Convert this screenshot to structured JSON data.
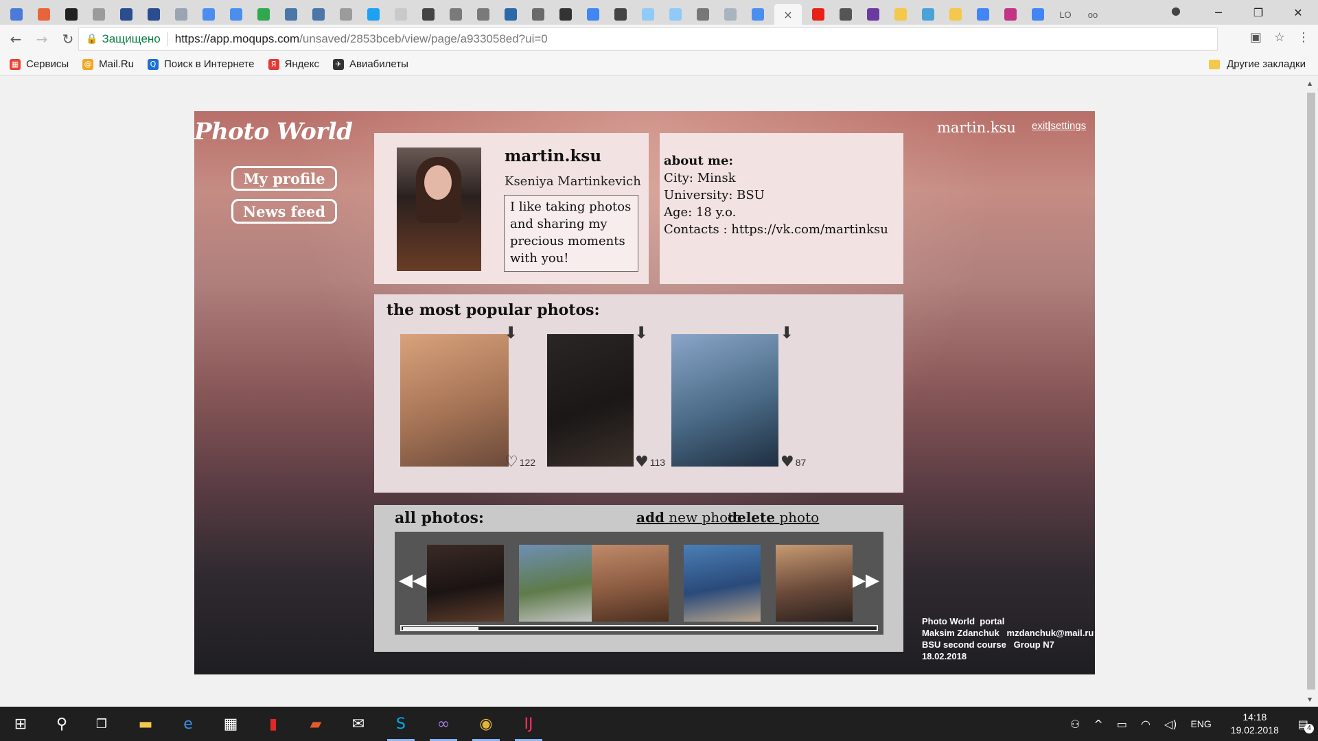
{
  "browser": {
    "tab_favicons": [
      "#4b7bd8",
      "#e8643a",
      "#222222",
      "#9b9b9b",
      "#2a4d8f",
      "#2a4d8f",
      "#9aa4b3",
      "#4a8ef0",
      "#4a8ef0",
      "#2fa84f",
      "#4a76a8",
      "#4a76a8",
      "#9b9b9b",
      "#1da1f2",
      "#c9c9c9",
      "#444444",
      "#7a7a7a",
      "#7a7a7a",
      "#2a6aa8",
      "#6a6a6a",
      "#333333",
      "#4285f4",
      "#444444",
      "#90caf9",
      "#90caf9",
      "#777777",
      "#aab4c0",
      "#4a8ef0"
    ],
    "active_tab_close": "×",
    "tabs_after": [
      "#e62117",
      "#555555",
      "#6a3aa1",
      "#f4c84a",
      "#4aa3d8",
      "#f4c84a",
      "#4285f4",
      "#c13584",
      "#4285f4"
    ],
    "tab_text_lo": "LO",
    "tab_text_oo": "oo",
    "window_minimize": "─",
    "window_restore": "❐",
    "window_close": "✕",
    "profile_icon": "●",
    "back_icon": "←",
    "forward_icon": "→",
    "reload_icon": "↻",
    "lock_icon": "🔒",
    "secure_label": "Защищено",
    "url_host": "https://app.moqups.com",
    "url_path": "/unsaved/2853bceb/view/page/a933058ed?ui=0",
    "translate_icon": "▣",
    "star_icon": "☆",
    "menu_icon": "⋮",
    "bookmarks": [
      {
        "label": "Сервисы",
        "icon": "apps-icon",
        "color": "#ea4335",
        "glyph": "▦"
      },
      {
        "label": "Mail.Ru",
        "icon": "mailru-icon",
        "color": "#f5a623",
        "glyph": "@"
      },
      {
        "label": "Поиск в Интернете",
        "icon": "search-icon",
        "color": "#1f6fd1",
        "glyph": "Q"
      },
      {
        "label": "Яндекс",
        "icon": "yandex-icon",
        "color": "#e53935",
        "glyph": "Я"
      },
      {
        "label": "Авиабилеты",
        "icon": "plane-icon",
        "color": "#333333",
        "glyph": "✈"
      }
    ],
    "other_bookmarks": "Другие закладки"
  },
  "app": {
    "logo": "Photo World",
    "nav_my_profile": "My profile",
    "nav_news_feed": "News feed",
    "top_username": "martin.ksu",
    "top_exit": "exit",
    "top_divider": "|",
    "top_settings": "settings",
    "profile": {
      "username": "martin.ksu",
      "full_name": "Kseniya Martinkevich",
      "bio": "I like taking photos and sharing my precious moments with you!"
    },
    "about": {
      "heading": "about me:",
      "city": "City: Minsk",
      "university": "University: BSU",
      "age": "Age: 18 y.o.",
      "contacts": "Contacts :  https://vk.com/martinksu"
    },
    "popular": {
      "title": "the most popular photos:",
      "photos": [
        {
          "likes": "122",
          "liked": false,
          "colors": [
            "#d9a27c",
            "#a67456",
            "#6b4a3a"
          ]
        },
        {
          "likes": "113",
          "liked": true,
          "colors": [
            "#2a2624",
            "#1a1716",
            "#3b302b"
          ]
        },
        {
          "likes": "87",
          "liked": true,
          "colors": [
            "#8aa5c8",
            "#4a6a86",
            "#1f2f40"
          ]
        }
      ],
      "download_icon": "⬇",
      "heart_empty": "♡",
      "heart_full": "♥"
    },
    "all_photos": {
      "title": "all photos:",
      "add_bold": "add",
      "add_rest": " new photo",
      "delete_bold": "delete",
      "delete_rest": " photo",
      "prev_icon": "◀◀",
      "next_icon": "▶▶",
      "scroll_position": 0.16,
      "thumbs": [
        {
          "colors": [
            "#3a2a26",
            "#1b1413",
            "#5c3d2c"
          ]
        },
        {
          "colors": [
            "#6e8fb4",
            "#5e7b4a",
            "#c7c7c7"
          ]
        },
        {
          "colors": [
            "#c08a6a",
            "#8a5a40",
            "#4a2f20"
          ]
        },
        {
          "colors": [
            "#4a7fb5",
            "#2a4a7a",
            "#b9a58c"
          ]
        },
        {
          "colors": [
            "#c79a72",
            "#6a4a3a",
            "#2a201c"
          ]
        }
      ]
    },
    "footer": "Photo World  portal\nMaksim Zdanchuk   mzdanchuk@mail.ru\nBSU second course   Group N7\n18.02.2018"
  },
  "taskbar": {
    "start_icon": "⊞",
    "search_icon": "⚲",
    "taskview_icon": "❐",
    "apps": [
      {
        "name": "explorer-icon",
        "glyph": "▬",
        "color": "#f4c84a",
        "open": false
      },
      {
        "name": "edge-icon",
        "glyph": "e",
        "color": "#3a8ee6",
        "open": false
      },
      {
        "name": "store-icon",
        "glyph": "▦",
        "color": "#ffffff",
        "open": false
      },
      {
        "name": "flipboard-icon",
        "glyph": "▮",
        "color": "#e12828",
        "open": false
      },
      {
        "name": "reader-icon",
        "glyph": "▰",
        "color": "#e25b2a",
        "open": false
      },
      {
        "name": "mail-icon",
        "glyph": "✉",
        "color": "#ffffff",
        "open": false
      },
      {
        "name": "skype-icon",
        "glyph": "S",
        "color": "#00aff0",
        "open": true
      },
      {
        "name": "visualstudio-icon",
        "glyph": "∞",
        "color": "#a77ae0",
        "open": true
      },
      {
        "name": "chrome-icon",
        "glyph": "◉",
        "color": "#e2b53a",
        "open": true
      },
      {
        "name": "intellij-icon",
        "glyph": "IJ",
        "color": "#fe315d",
        "open": true
      }
    ],
    "tray_people": "⚇",
    "tray_chevron": "^",
    "tray_battery": "▭",
    "tray_wifi": "◠",
    "tray_volume": "◁)",
    "lang": "ENG",
    "time": "14:18",
    "date": "19.02.2018",
    "notif_icon": "▤",
    "notif_count": "4"
  }
}
